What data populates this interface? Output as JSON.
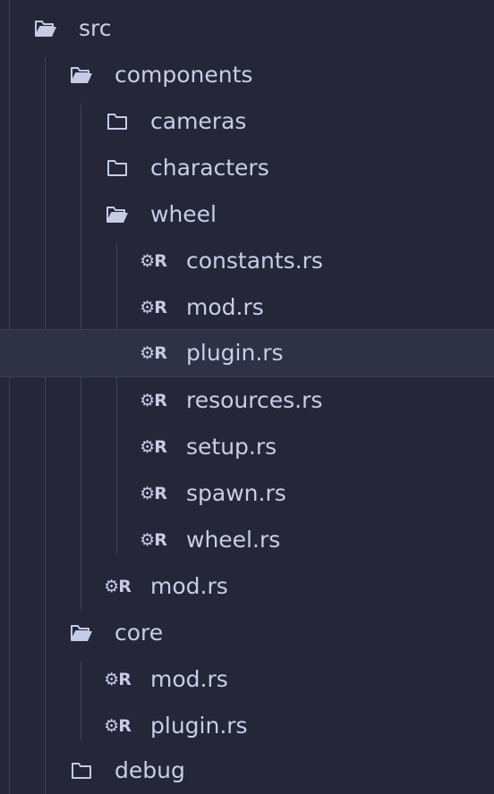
{
  "tree": {
    "nodes": [
      {
        "label": "src",
        "kind": "folder-open"
      },
      {
        "label": "components",
        "kind": "folder-open"
      },
      {
        "label": "cameras",
        "kind": "folder-closed"
      },
      {
        "label": "characters",
        "kind": "folder-closed"
      },
      {
        "label": "wheel",
        "kind": "folder-open"
      },
      {
        "label": "constants.rs",
        "kind": "rust-file"
      },
      {
        "label": "mod.rs",
        "kind": "rust-file"
      },
      {
        "label": "plugin.rs",
        "kind": "rust-file",
        "selected": true
      },
      {
        "label": "resources.rs",
        "kind": "rust-file"
      },
      {
        "label": "setup.rs",
        "kind": "rust-file"
      },
      {
        "label": "spawn.rs",
        "kind": "rust-file"
      },
      {
        "label": "wheel.rs",
        "kind": "rust-file"
      },
      {
        "label": "mod.rs",
        "kind": "rust-file"
      },
      {
        "label": "core",
        "kind": "folder-open"
      },
      {
        "label": "mod.rs",
        "kind": "rust-file"
      },
      {
        "label": "plugin.rs",
        "kind": "rust-file"
      },
      {
        "label": "debug",
        "kind": "folder-closed"
      }
    ]
  },
  "colors": {
    "background": "#252638",
    "text": "#c9cde8",
    "selected_row": "#2f3144",
    "indent_guide": "#3f4158"
  }
}
